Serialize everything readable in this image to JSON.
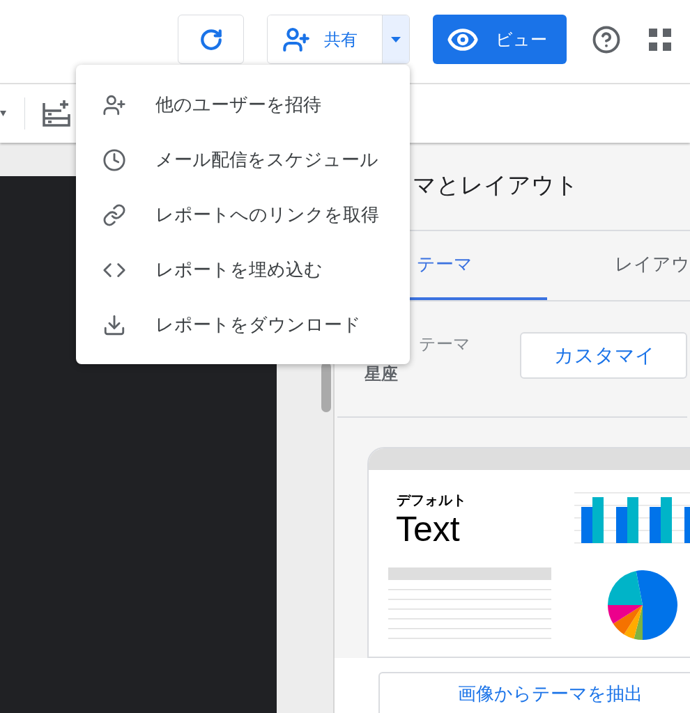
{
  "header": {
    "share_button": "共有",
    "view_button": "ビュー"
  },
  "share_menu": [
    {
      "kind": "invite",
      "label": "他のユーザーを招待"
    },
    {
      "kind": "schedule",
      "label": "メール配信をスケジュール"
    },
    {
      "kind": "link",
      "label": "レポートへのリンクを取得"
    },
    {
      "kind": "embed",
      "label": "レポートを埋め込む"
    },
    {
      "kind": "download",
      "label": "レポートをダウンロード"
    }
  ],
  "panel": {
    "title": "マとレイアウト",
    "tabs": [
      {
        "label": "テーマ",
        "selected": true
      },
      {
        "label": "レイアウ",
        "selected": false
      }
    ],
    "current_theme": {
      "label": "テーマ",
      "value": "星座"
    },
    "customize_button": "カスタマイ",
    "preview": {
      "heading": "デフォルト",
      "sample": "Text"
    },
    "extract_button": "画像からテーマを抽出"
  }
}
